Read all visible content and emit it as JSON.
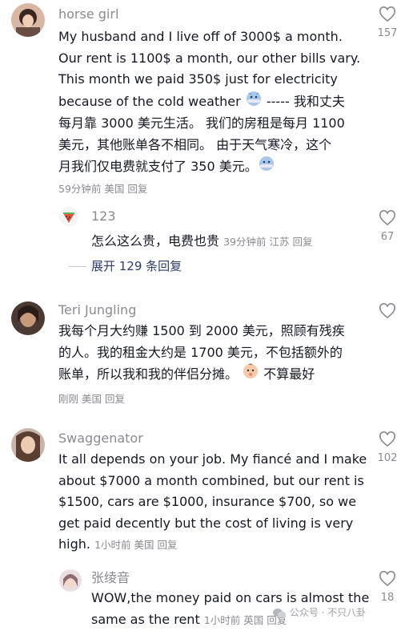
{
  "comments": [
    {
      "username": "horse girl",
      "lines": [
        "My husband and I live off of 3000$ a month.",
        "Our rent is 1100$ a month, our other bills vary.",
        "This month we paid 350$ just for electricity",
        "because of the cold weather",
        " -----  我和丈夫",
        "每月靠 3000 美元生活。 我们的房租是每月 1100",
        "美元，其他账单各不相同。 由于天气寒冷，这个",
        "月我们仅电费就支付了 350 美元。"
      ],
      "meta": "59分钟前 美国 回复",
      "likes": "157",
      "replies": [
        {
          "username": "123",
          "text": "怎么这么贵，电费也贵",
          "meta": "39分钟前 江苏 回复",
          "likes": "67"
        }
      ],
      "expand_label": "展开 129 条回复"
    },
    {
      "username": "Teri Jungling",
      "lines": [
        "我每个月大约赚 1500 到 2000 美元，照顾有残疾",
        "的人。我的租金大约是 1700 美元，不包括额外的",
        "账单，所以我和我的伴侣分摊。",
        "不算最好"
      ],
      "meta": "刚刚 美国 回复",
      "likes": ""
    },
    {
      "username": "Swaggenator",
      "lines": [
        "It all depends on your job. My fiancé and I make",
        "about $7000 a month combined, but our rent is",
        "$1500, cars are $1000, insurance $700, so we",
        "get paid decently but the cost of living is very",
        "high."
      ],
      "meta": "1小时前 美国 回复",
      "likes": "102",
      "replies": [
        {
          "username": "张绫音",
          "lines": [
            "WOW,the money paid on cars is almost the",
            "same as the rent"
          ],
          "meta": "1小时前 英国 回复",
          "likes": "18"
        }
      ]
    }
  ],
  "watermark": "公众号 · 不只八卦",
  "icons": {
    "like": "heart-outline-icon",
    "cold_face": "cold-face-emoji",
    "baby_face": "baby-face-emoji",
    "wechat": "wechat-icon"
  },
  "colors": {
    "text": "#161823",
    "meta": "#8a8b91",
    "link": "#2e3d6b"
  }
}
